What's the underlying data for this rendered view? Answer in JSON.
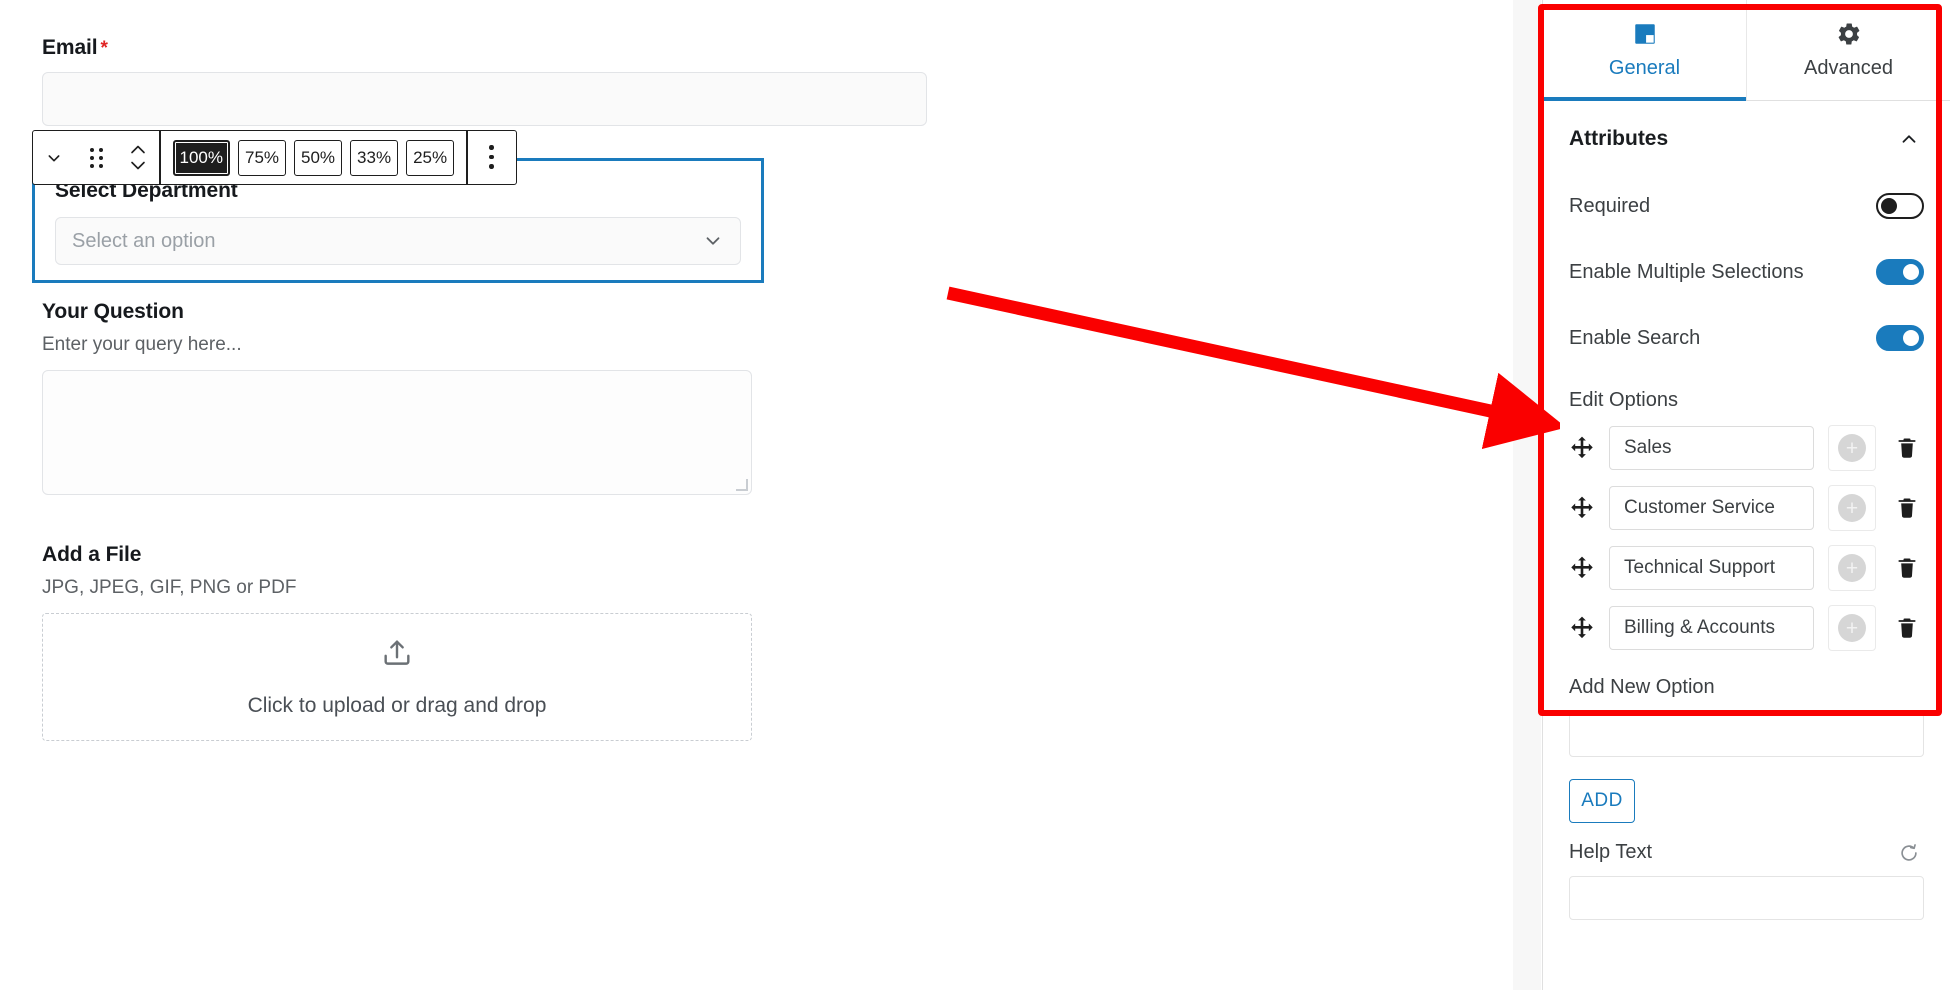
{
  "form": {
    "email": {
      "label": "Email",
      "required_marker": "*",
      "value": "",
      "placeholder": ""
    },
    "select_department": {
      "label": "Select Department",
      "placeholder": "Select an option",
      "chevron_icon": "chevron-down-icon"
    },
    "your_question": {
      "label": "Your Question",
      "help": "Enter your query here...",
      "value": ""
    },
    "add_a_file": {
      "label": "Add a File",
      "help": "JPG, JPEG, GIF, PNG or PDF",
      "dropzone_text": "Click to upload or drag and drop",
      "upload_icon": "upload-icon"
    }
  },
  "block_toolbar": {
    "chevron_icon": "chevron-down-icon",
    "drag_icon": "drag-dots-icon",
    "move_icon": "move-up-down-icon",
    "more_icon": "more-vertical-icon",
    "width_options": [
      {
        "label": "100%",
        "active": true
      },
      {
        "label": "75%",
        "active": false
      },
      {
        "label": "50%",
        "active": false
      },
      {
        "label": "33%",
        "active": false
      },
      {
        "label": "25%",
        "active": false
      }
    ]
  },
  "panel": {
    "tabs": [
      {
        "label": "General",
        "icon": "block-square-icon",
        "active": true
      },
      {
        "label": "Advanced",
        "icon": "gear-icon",
        "active": false
      }
    ],
    "section": {
      "title": "Attributes",
      "collapse_icon": "chevron-up-icon",
      "properties": [
        {
          "label": "Required",
          "state": "off"
        },
        {
          "label": "Enable Multiple Selections",
          "state": "on"
        },
        {
          "label": "Enable Search",
          "state": "on"
        }
      ],
      "edit_options_label": "Edit Options",
      "options": [
        {
          "value": "Sales",
          "drag_icon": "move-arrows-icon",
          "add_icon": "plus-icon",
          "delete_icon": "trash-icon"
        },
        {
          "value": "Customer Service",
          "drag_icon": "move-arrows-icon",
          "add_icon": "plus-icon",
          "delete_icon": "trash-icon"
        },
        {
          "value": "Technical Support",
          "drag_icon": "move-arrows-icon",
          "add_icon": "plus-icon",
          "delete_icon": "trash-icon"
        },
        {
          "value": "Billing & Accounts",
          "drag_icon": "move-arrows-icon",
          "add_icon": "plus-icon",
          "delete_icon": "trash-icon"
        }
      ],
      "add_new_option_label": "Add New Option",
      "add_new_option_value": "",
      "add_button_label": "ADD"
    },
    "help_text": {
      "label": "Help Text",
      "reset_icon": "reset-icon",
      "value": ""
    }
  },
  "annotation": {
    "highlight_color": "#fa0000",
    "arrow_icon": "red-arrow-icon"
  },
  "colors": {
    "accent": "#1a7bbd",
    "selected_block_border": "#1a7bbd",
    "required_star": "#e02424",
    "toolbar_active_bg": "#1e1e1e"
  }
}
